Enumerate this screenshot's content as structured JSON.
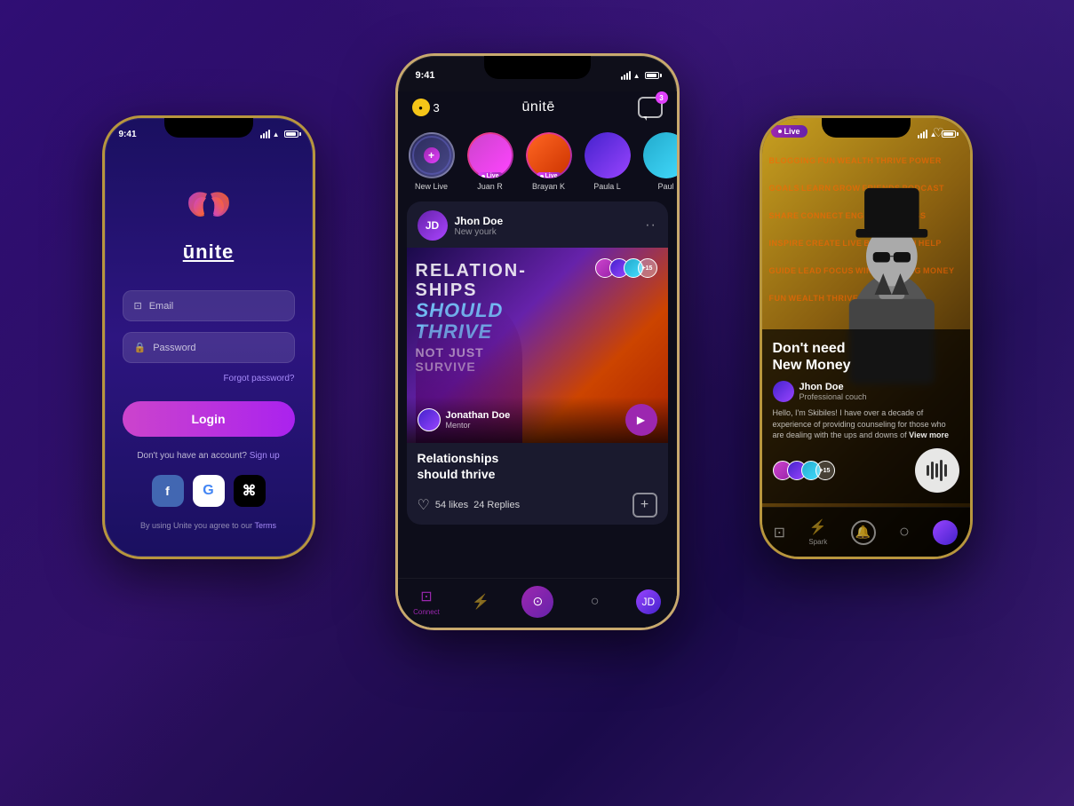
{
  "app": {
    "name": "unite",
    "background": "#1a0a4a"
  },
  "left_phone": {
    "status_time": "9:41",
    "logo_name": "ūnite",
    "email_placeholder": "Email",
    "password_placeholder": "Password",
    "forgot_password": "Forgot password?",
    "login_button": "Login",
    "no_account_text": "Don't you have an account?",
    "signup_link": "Sign up",
    "social_fb": "f",
    "social_g": "G",
    "social_apple": "",
    "terms_text": "By using Unite you agree to our",
    "terms_link": "Terms"
  },
  "center_phone": {
    "status_time": "9:41",
    "app_title": "ūnitē",
    "coin_count": "3",
    "chat_badge": "3",
    "stories": [
      {
        "label": "New Live",
        "type": "new"
      },
      {
        "label": "Juan R",
        "type": "live"
      },
      {
        "label": "Brayan K",
        "type": "live"
      },
      {
        "label": "Paula L",
        "type": "normal"
      },
      {
        "label": "Paul",
        "type": "normal"
      }
    ],
    "post": {
      "user_name": "Jhon Doe",
      "user_location": "New yourk",
      "image_title_line1": "Relationships",
      "image_title_line2": "should thrive",
      "art_words": [
        "RELATION",
        "SHOULD",
        "NOT JUST",
        "SURVIVE"
      ],
      "likes_count": "54 likes",
      "replies_count": "24 Replies",
      "author_name": "Jonathan Doe",
      "author_role": "Mentor",
      "overlap_count": "+15"
    },
    "nav": {
      "connect": "Connect",
      "spark": "⚡",
      "home": "○",
      "profile": "👤"
    }
  },
  "right_phone": {
    "status_time": "9:41",
    "live_label": "Live",
    "song_title": "Don't need\nNew Money",
    "artist_name": "Jhon Doe",
    "artist_role": "Professional couch",
    "description": "Hello, I'm Skibiles! I have over a decade of experience of providing counseling for those who are dealing with the ups and downs of",
    "view_more": "View more",
    "listener_count": "+15",
    "marquee_words": [
      "BLOGGING",
      "FUN",
      "WEALTH",
      "THRIVE",
      "POWER",
      "GOALS",
      "LEARN",
      "GROW",
      "FRIENDS",
      "PODCAST",
      "SHARE",
      "CONNECT",
      "ENGAGE",
      "SUCCESS",
      "INSPIRE",
      "CREATE",
      "LIVE",
      "BUILD",
      "EARN",
      "HELP",
      "GUIDE",
      "LEAD",
      "FOCUS",
      "WIN"
    ]
  }
}
